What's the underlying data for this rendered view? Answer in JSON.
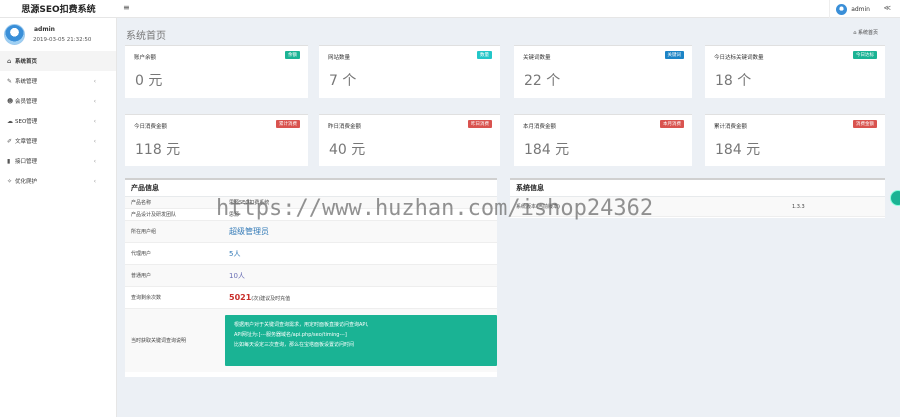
{
  "app": {
    "title": "思源SEO扣费系统"
  },
  "topbar": {
    "menu_icon": "≡",
    "username": "admin",
    "share_icon": "≪"
  },
  "user": {
    "name": "admin",
    "time": "2019-03-05 21:32:50"
  },
  "sidebar": {
    "items": [
      {
        "label": "系统首页",
        "icon": "home-icon",
        "glyph": "⌂",
        "active": true,
        "chevron": ""
      },
      {
        "label": "系统管理",
        "icon": "wrench-icon",
        "glyph": "✎",
        "active": false,
        "chevron": "‹"
      },
      {
        "label": "会员管理",
        "icon": "users-icon",
        "glyph": "☻",
        "active": false,
        "chevron": "‹"
      },
      {
        "label": "SEO管理",
        "icon": "cloud-icon",
        "glyph": "☁",
        "active": false,
        "chevron": "‹"
      },
      {
        "label": "文章管理",
        "icon": "edit-icon",
        "glyph": "✐",
        "active": false,
        "chevron": "‹"
      },
      {
        "label": "接口管理",
        "icon": "chart-icon",
        "glyph": "▮",
        "active": false,
        "chevron": "‹"
      },
      {
        "label": "优化爬护",
        "icon": "magic-icon",
        "glyph": "✧",
        "active": false,
        "chevron": "‹"
      }
    ]
  },
  "page": {
    "title": "系统首页",
    "breadcrumb_icon": "⌂",
    "breadcrumb": "系统首页"
  },
  "stats_row1": [
    {
      "title": "账户余额",
      "badge": "余额",
      "badge_color": "#1ab394",
      "value": "0 元"
    },
    {
      "title": "网站数量",
      "badge": "数量",
      "badge_color": "#23c6c8",
      "value": "7 个"
    },
    {
      "title": "关键词数量",
      "badge": "关键词",
      "badge_color": "#1c84c6",
      "value": "22 个"
    },
    {
      "title": "今日达标关键词数量",
      "badge": "今日达标",
      "badge_color": "#1ab394",
      "value": "18 个"
    }
  ],
  "stats_row2": [
    {
      "title": "今日消费金额",
      "badge": "累计消费",
      "badge_color": "#d9534f",
      "value": "118 元"
    },
    {
      "title": "昨日消费金额",
      "badge": "昨日消费",
      "badge_color": "#d9534f",
      "value": "40 元"
    },
    {
      "title": "本月消费金额",
      "badge": "本月消费",
      "badge_color": "#d9534f",
      "value": "184 元"
    },
    {
      "title": "累计消费金额",
      "badge": "消费金额",
      "badge_color": "#d9534f",
      "value": "184 元"
    }
  ],
  "product_panel": {
    "title": "产品信息",
    "rows": [
      {
        "key": "产品名称",
        "value": "思源SEO扣费系统"
      },
      {
        "key": "产品设计及研发团队",
        "value": "思源"
      },
      {
        "key": "所在用户组",
        "value": "超级管理员"
      },
      {
        "key": "代理用户",
        "value": "5人"
      },
      {
        "key": "普通用户",
        "value": "10人"
      },
      {
        "key": "查询剩余次数",
        "value": "5021",
        "suffix": "(次)建议及时充值"
      },
      {
        "key": "当时获取关键词查询说明",
        "note_lines": [
          "根据用户对于关键词查询需求，用定时面板直接访问查询API,",
          "API网址为:[---服务器域名/api.php/seo/timing---]",
          "比如每天设定三次查询，那么在宝塔面板设置访问时间"
        ]
      }
    ]
  },
  "system_panel": {
    "title": "系统信息",
    "rows": [
      {
        "key": "系统版本(当前版本)",
        "value": "1.3.3"
      }
    ]
  },
  "watermark": "https://www.huzhan.com/ishop24362"
}
